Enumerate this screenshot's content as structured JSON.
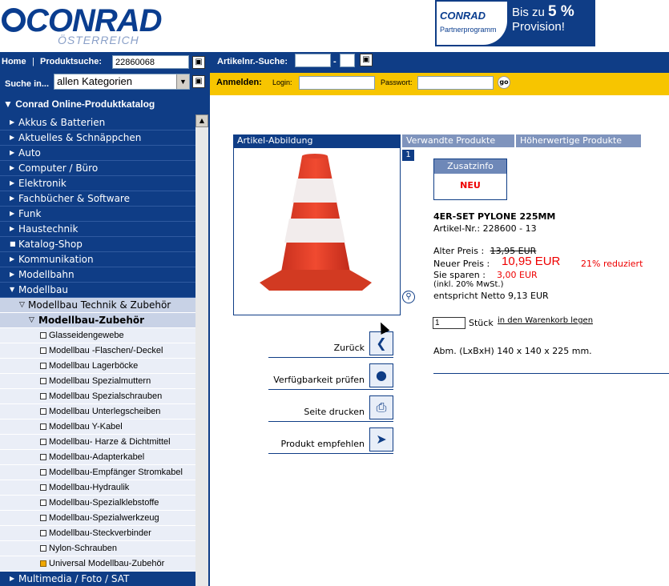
{
  "header": {
    "logo_main": "CONRAD",
    "logo_sub": "ÖSTERREICH",
    "banner": {
      "brand": "CONRAD",
      "sub": "Partnerprogramm",
      "line1_pre": "Bis zu ",
      "line1_pct": "5 %",
      "line2": "Provision!"
    }
  },
  "topbar": {
    "home": "Home",
    "produktsuche_label": "Produktsuche:",
    "produktsuche_value": "22860068",
    "artikelnr_label": "Artikelnr.-Suche:",
    "artikelnr_sep": "-",
    "suche_in_label": "Suche in...",
    "suche_in_value": "allen Kategorien",
    "anmelden": "Anmelden:",
    "login_label": "Login:",
    "passwort_label": "Passwort:",
    "go": "go"
  },
  "sidebar": {
    "title": "Conrad Online-Produktkatalog",
    "categories": [
      {
        "label": "Akkus & Batterien",
        "icon": "triangle-right"
      },
      {
        "label": "Aktuelles & Schnäppchen",
        "icon": "triangle-right"
      },
      {
        "label": "Auto",
        "icon": "triangle-right"
      },
      {
        "label": "Computer / Büro",
        "icon": "triangle-right"
      },
      {
        "label": "Elektronik",
        "icon": "triangle-right"
      },
      {
        "label": "Fachbücher & Software",
        "icon": "triangle-right"
      },
      {
        "label": "Funk",
        "icon": "triangle-right"
      },
      {
        "label": "Haustechnik",
        "icon": "triangle-right"
      },
      {
        "label": "Katalog-Shop",
        "icon": "square"
      },
      {
        "label": "Kommunikation",
        "icon": "triangle-right"
      },
      {
        "label": "Modellbahn",
        "icon": "triangle-right"
      },
      {
        "label": "Modellbau",
        "icon": "triangle-down"
      }
    ],
    "sub1": "Modellbau Technik & Zubehör",
    "sub2": "Modellbau-Zubehör",
    "leaves": [
      "Glasseidengewebe",
      "Modellbau -Flaschen/-Deckel",
      "Modellbau Lagerböcke",
      "Modellbau Spezialmuttern",
      "Modellbau Spezialschrauben",
      "Modellbau Unterlegscheiben",
      "Modellbau Y-Kabel",
      "Modellbau- Harze & Dichtmittel",
      "Modellbau-Adapterkabel",
      "Modellbau-Empfänger Stromkabel",
      "Modellbau-Hydraulik",
      "Modellbau-Spezialklebstoffe",
      "Modellbau-Spezialwerkzeug",
      "Modellbau-Steckverbinder",
      "Nylon-Schrauben",
      "Universal Modellbau-Zubehör"
    ],
    "after": "Multimedia / Foto / SAT"
  },
  "tabs": [
    "Artikel-Abbildung",
    "Verwandte Produkte",
    "Höherwertige Produkte"
  ],
  "image_count": "1",
  "zusatzinfo": {
    "header": "Zusatzinfo",
    "badge": "NEU"
  },
  "product": {
    "title": "4ER-SET PYLONE 225MM",
    "artikelnr": "Artikel-Nr.: 228600 -  13",
    "alter_preis_label": "Alter Preis :",
    "alter_preis": "13,95 EUR",
    "neuer_preis_label": "Neuer Preis :",
    "neuer_preis": "10,95 EUR",
    "reduziert": "21% reduziert",
    "sparen_label": "Sie sparen :",
    "sparen": "3,00 EUR",
    "mwst": "(inkl. 20% MwSt.)",
    "netto": "entspricht Netto 9,13 EUR",
    "qty": "1",
    "stueck": "Stück",
    "warenkorb": "in den Warenkorb legen",
    "abm": "Abm. (LxBxH) 140 x 140 x 225 mm."
  },
  "actions": [
    {
      "label": "Zurück",
      "icon": "back-icon"
    },
    {
      "label": "Verfügbarkeit prüfen",
      "icon": "traffic-light-icon"
    },
    {
      "label": "Seite drucken",
      "icon": "printer-icon"
    },
    {
      "label": "Produkt empfehlen",
      "icon": "recommend-icon"
    }
  ]
}
